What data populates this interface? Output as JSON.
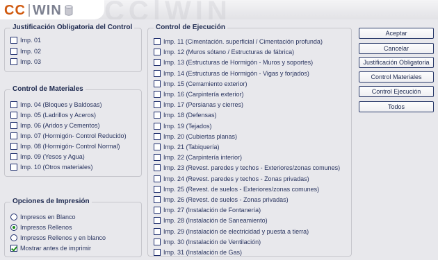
{
  "logo": {
    "cc": "CC",
    "win": "WIN",
    "watermark": "CC|WIN"
  },
  "colors": {
    "background": "#e8e8ec",
    "logo_orange": "#d05a10",
    "check_green": "#1a8a1a"
  },
  "justificacion": {
    "title": "Justificación Obligatoria del Control",
    "items": [
      {
        "label": "Imp. 01",
        "checked": false
      },
      {
        "label": "Imp. 02",
        "checked": false
      },
      {
        "label": "Imp. 03",
        "checked": false
      }
    ]
  },
  "materiales": {
    "title": "Control  de Materiales",
    "items": [
      {
        "label": "Imp. 04 (Bloques y Baldosas)",
        "checked": false
      },
      {
        "label": "Imp. 05 (Ladrillos y Aceros)",
        "checked": false
      },
      {
        "label": "Imp. 06 (Aridos y Cementos)",
        "checked": false
      },
      {
        "label": "Imp. 07 (Hormigón- Control Reducido)",
        "checked": false
      },
      {
        "label": "Imp. 08 (Hormigón- Control Normal)",
        "checked": false
      },
      {
        "label": "Imp. 09 (Yesos y Agua)",
        "checked": false
      },
      {
        "label": "Imp. 10 (Otros materiales)",
        "checked": false
      }
    ]
  },
  "opciones": {
    "title": "Opciones de Impresión",
    "radios": [
      {
        "label": "Impresos en Blanco",
        "checked": false
      },
      {
        "label": "Impresos Rellenos",
        "checked": true
      },
      {
        "label": "Impresos Rellenos y en blanco",
        "checked": false
      }
    ],
    "mostrar": {
      "label": "Mostrar antes de imprimir",
      "checked": true
    }
  },
  "ejecucion": {
    "title": "Control  de Ejecución",
    "items": [
      {
        "label": "Imp. 11 (Cimentación. superficial / Cimentación profunda)",
        "checked": false
      },
      {
        "label": "Imp. 12 (Muros sótano / Estructuras de fábrica)",
        "checked": false
      },
      {
        "label": "Imp. 13 (Estructuras de Hormigón - Muros y soportes)",
        "checked": false
      },
      {
        "label": "Imp. 14 (Estructuras de Hormigón - Vigas y forjados)",
        "checked": false
      },
      {
        "label": "Imp. 15 (Cerramiento exterior)",
        "checked": false
      },
      {
        "label": "Imp. 16 (Carpintería exterior)",
        "checked": false
      },
      {
        "label": "Imp. 17 (Persianas y cierres)",
        "checked": false
      },
      {
        "label": "Imp. 18 (Defensas)",
        "checked": false
      },
      {
        "label": "Imp. 19 (Tejados)",
        "checked": false
      },
      {
        "label": "Imp. 20 (Cubiertas planas)",
        "checked": false
      },
      {
        "label": "Imp. 21 (Tabiquería)",
        "checked": false
      },
      {
        "label": "Imp. 22 (Carpintería interior)",
        "checked": false
      },
      {
        "label": "Imp. 23 (Revest. paredes y techos - Exteriores/zonas comunes)",
        "checked": false
      },
      {
        "label": "Imp. 24 (Revest. paredes y techos - Zonas privadas)",
        "checked": false
      },
      {
        "label": "Imp. 25 (Revest. de suelos - Exteriores/zonas comunes)",
        "checked": false
      },
      {
        "label": "Imp. 26 (Revest. de suelos - Zonas privadas)",
        "checked": false
      },
      {
        "label": "Imp. 27 (Instalación de Fontanería)",
        "checked": false
      },
      {
        "label": "Imp. 28 (Instalación de Saneamiento)",
        "checked": false
      },
      {
        "label": "Imp. 29 (Instalación de electricidad y puesta a tierra)",
        "checked": false
      },
      {
        "label": "Imp. 30 (Instalación de Ventilación)",
        "checked": false
      },
      {
        "label": "Imp. 31 (Instalación de Gas)",
        "checked": false
      }
    ]
  },
  "buttons": [
    {
      "label": "Aceptar",
      "name": "aceptar-button"
    },
    {
      "label": "Cancelar",
      "name": "cancelar-button"
    },
    {
      "label": "Justificación Obligatoria",
      "name": "justificacion-obligatoria-button"
    },
    {
      "label": "Control Materiales",
      "name": "control-materiales-button"
    },
    {
      "label": "Control Ejecución",
      "name": "control-ejecucion-button"
    },
    {
      "label": "Todos",
      "name": "todos-button"
    }
  ]
}
